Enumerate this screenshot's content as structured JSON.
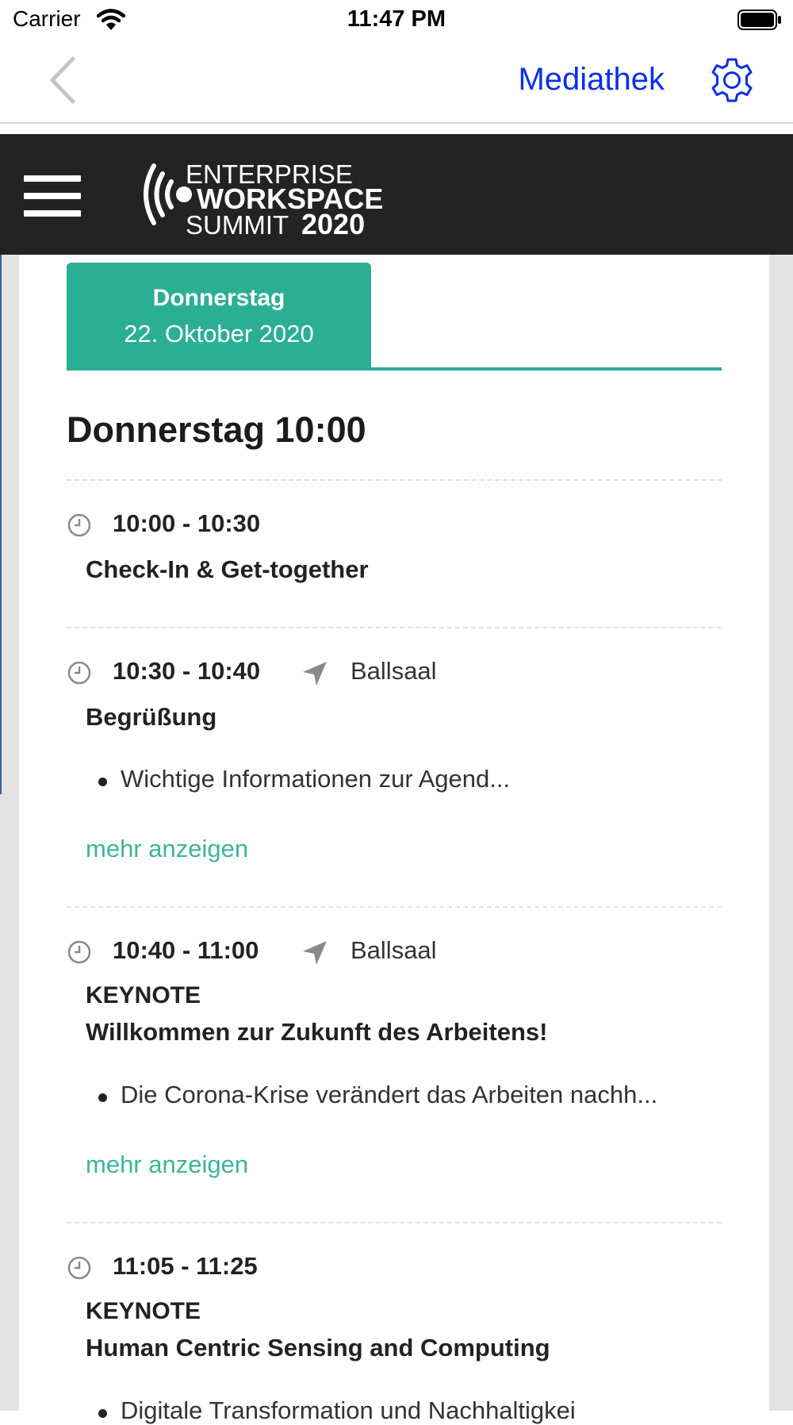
{
  "status_bar": {
    "carrier": "Carrier",
    "time": "11:47 PM"
  },
  "nav_bar": {
    "title_link": "Mediathek"
  },
  "header": {
    "logo": {
      "line1": "ENTERPRISE",
      "line2": "WORKSPACE",
      "line3": "SUMMIT",
      "year": "2020"
    }
  },
  "tabs": [
    {
      "day": "Donnerstag",
      "date": "22. Oktober 2020",
      "active": true
    }
  ],
  "section_heading": "Donnerstag 10:00",
  "sessions": [
    {
      "time": "10:00 - 10:30",
      "title": "Check-In & Get-together"
    },
    {
      "time": "10:30 - 10:40",
      "location": "Ballsaal",
      "title": "Begrüßung",
      "bullet": "Wichtige Informationen zur Agend...",
      "more": "mehr anzeigen"
    },
    {
      "time": "10:40 - 11:00",
      "location": "Ballsaal",
      "kind": "KEYNOTE",
      "title": "Willkommen zur Zukunft des Arbeitens!",
      "bullet": "Die Corona-Krise verändert das Arbeiten nachh...",
      "more": "mehr anzeigen"
    },
    {
      "time": "11:05 - 11:25",
      "kind": "KEYNOTE",
      "title": "Human Centric Sensing and Computing",
      "bullet": "Digitale Transformation und Nachhaltigkei"
    }
  ],
  "colors": {
    "accent": "#2aaf94",
    "link": "#3db49a",
    "nav_link": "#0b2ee8",
    "header_bg": "#232323"
  }
}
